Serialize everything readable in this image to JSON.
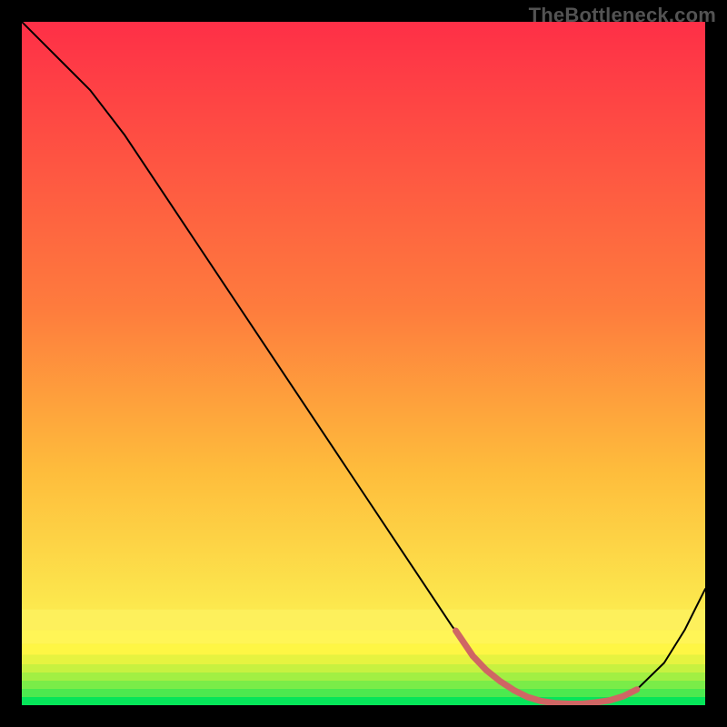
{
  "attribution": "TheBottleneck.com",
  "chart_data": {
    "type": "line",
    "title": "",
    "xlabel": "",
    "ylabel": "",
    "xlim": [
      0,
      100
    ],
    "ylim": [
      0,
      100
    ],
    "grid": false,
    "legend": false,
    "series": [
      {
        "name": "bottleneck-curve",
        "color": "#000000",
        "stroke_width": 2,
        "x": [
          0,
          3,
          6,
          10,
          15,
          20,
          25,
          30,
          35,
          40,
          45,
          50,
          55,
          60,
          63,
          66,
          70,
          74,
          78,
          82,
          86,
          90,
          94,
          97,
          100
        ],
        "y": [
          100,
          97,
          94,
          90,
          83.5,
          76,
          68.5,
          61,
          53.5,
          46,
          38.5,
          31,
          23.5,
          16,
          11.5,
          7.5,
          3.5,
          1.2,
          0.3,
          0.2,
          0.7,
          2.3,
          6.2,
          11,
          17
        ]
      },
      {
        "name": "optimal-zone-marker",
        "color": "#cf6664",
        "stroke_width": 7,
        "x": [
          63.5,
          66,
          68,
          70,
          72,
          74,
          76,
          78,
          80,
          82,
          84,
          86,
          88,
          90
        ],
        "y": [
          10.9,
          7.2,
          5.1,
          3.5,
          2.2,
          1.2,
          0.6,
          0.3,
          0.2,
          0.2,
          0.4,
          0.7,
          1.3,
          2.3
        ]
      }
    ],
    "background_bands": [
      {
        "from_y": 0.0,
        "to_y": 1.2,
        "color": "#06e559"
      },
      {
        "from_y": 1.2,
        "to_y": 2.4,
        "color": "#4ce94f"
      },
      {
        "from_y": 2.4,
        "to_y": 3.6,
        "color": "#7aec48"
      },
      {
        "from_y": 3.6,
        "to_y": 4.8,
        "color": "#a2ef43"
      },
      {
        "from_y": 4.8,
        "to_y": 6.0,
        "color": "#c7f140"
      },
      {
        "from_y": 6.0,
        "to_y": 7.4,
        "color": "#e6f340"
      },
      {
        "from_y": 7.4,
        "to_y": 9.0,
        "color": "#fef644"
      },
      {
        "from_y": 9.0,
        "to_y": 11.0,
        "color": "#fff556"
      },
      {
        "from_y": 11.0,
        "to_y": 14.0,
        "color": "#fdf05c"
      }
    ],
    "background_gradient": {
      "top_color": "#fe2f47",
      "mid1_color": "#fe7c3d",
      "mid2_color": "#febd3c",
      "bottom_color": "#fce94e",
      "top_stop": 0.0,
      "mid1_stop": 0.42,
      "mid2_stop": 0.66,
      "bottom_stop": 0.86
    }
  }
}
